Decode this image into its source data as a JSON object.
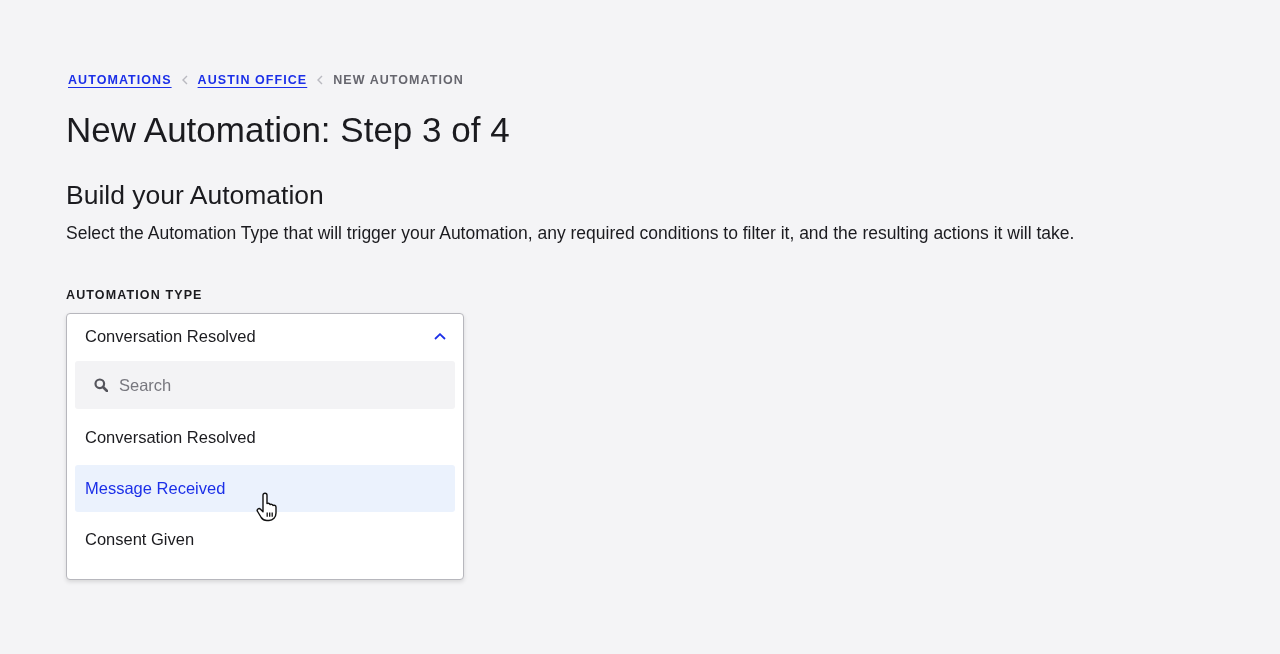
{
  "breadcrumb": [
    {
      "label": "AUTOMATIONS",
      "kind": "link"
    },
    {
      "label": "AUSTIN OFFICE",
      "kind": "link"
    },
    {
      "label": "NEW AUTOMATION",
      "kind": "current"
    }
  ],
  "title": "New Automation: Step 3 of 4",
  "section": {
    "heading": "Build your Automation",
    "description": "Select the Automation Type that will trigger your Automation, any required conditions to filter it, and the resulting actions it will take."
  },
  "automation_type": {
    "label": "AUTOMATION TYPE",
    "value": "Conversation Resolved",
    "expanded": true,
    "search": {
      "placeholder": "Search"
    },
    "options": [
      {
        "label": "Conversation Resolved",
        "highlighted": false
      },
      {
        "label": "Message Received",
        "highlighted": true
      },
      {
        "label": "Consent Given",
        "highlighted": false
      }
    ]
  }
}
